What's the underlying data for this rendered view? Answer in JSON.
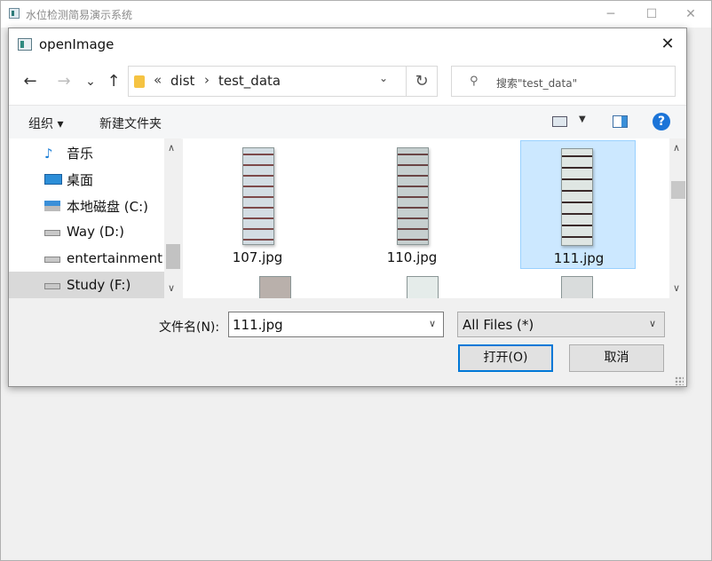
{
  "main_window": {
    "title": "水位检测简易演示系统"
  },
  "dialog": {
    "title": "openImage",
    "close_label": "✕",
    "nav": {
      "back": "←",
      "forward": "→",
      "recent": "⌄",
      "up": "↑"
    },
    "address": {
      "overflow": "«",
      "parts": [
        "dist",
        "test_data"
      ],
      "separator": "›"
    },
    "refresh": "↻",
    "search": {
      "placeholder": "搜索\"test_data\""
    },
    "toolbar": {
      "organize": "组织 ▾",
      "new_folder": "新建文件夹",
      "help": "?"
    },
    "nav_pane": {
      "items": [
        {
          "label": "音乐",
          "icon": "music-icon"
        },
        {
          "label": "桌面",
          "icon": "desktop-icon"
        },
        {
          "label": "本地磁盘 (C:)",
          "icon": "windows-drive-icon"
        },
        {
          "label": "Way (D:)",
          "icon": "drive-icon"
        },
        {
          "label": "entertainment",
          "icon": "drive-icon"
        },
        {
          "label": "Study (F:)",
          "icon": "drive-icon",
          "selected": true
        }
      ]
    },
    "files": [
      {
        "name": "107.jpg"
      },
      {
        "name": "110.jpg"
      },
      {
        "name": "111.jpg",
        "selected": true
      }
    ],
    "file_name_label": "文件名(N):",
    "file_name_value": "111.jpg",
    "file_type_value": "All Files  (*)",
    "open_button": "打开(O)",
    "cancel_button": "取消"
  },
  "colors": {
    "selection": "#cce8ff",
    "accent": "#0078d7",
    "help": "#1b74d8"
  }
}
